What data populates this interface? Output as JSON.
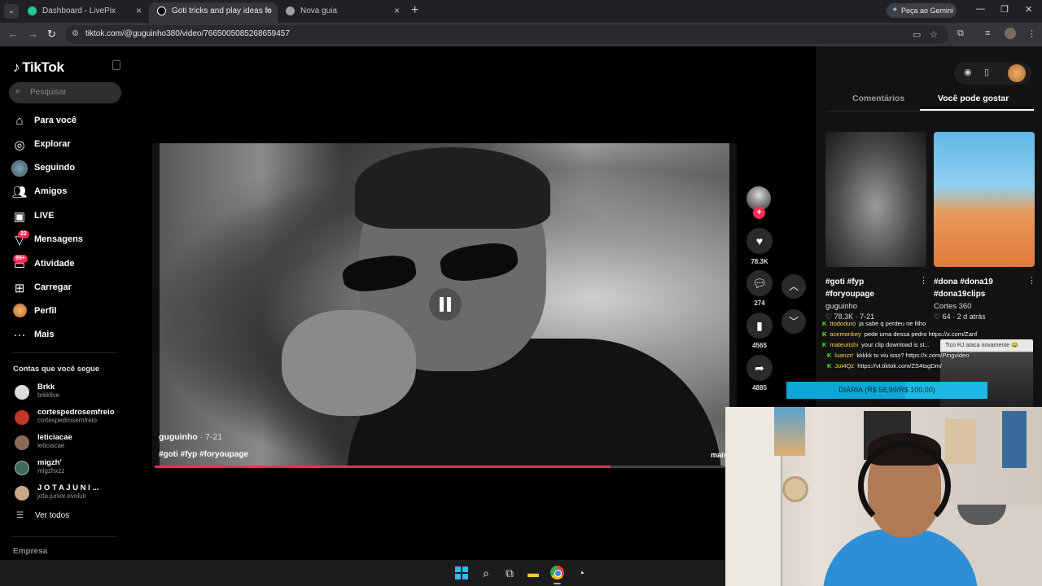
{
  "browser": {
    "tabs": [
      {
        "title": "Dashboard - LivePix",
        "active": false
      },
      {
        "title": "Goti tricks and play ideas fo",
        "active": true
      },
      {
        "title": "Nova guia",
        "active": false
      }
    ],
    "new_tab": "+",
    "gemini_label": "Peça ao Gemini",
    "url": "tiktok.com/@guguinho380/video/7665005085268659457"
  },
  "sidebar": {
    "logo": "TikTok",
    "search_placeholder": "Pesquisar",
    "nav": [
      {
        "label": "Para você",
        "icon": "home-icon"
      },
      {
        "label": "Explorar",
        "icon": "compass-icon"
      },
      {
        "label": "Seguindo",
        "icon": "following-avatar"
      },
      {
        "label": "Amigos",
        "icon": "friends-icon"
      },
      {
        "label": "LIVE",
        "icon": "live-icon"
      },
      {
        "label": "Mensagens",
        "icon": "messages-icon",
        "badge": "22"
      },
      {
        "label": "Atividade",
        "icon": "activity-icon",
        "badge": "99+"
      },
      {
        "label": "Carregar",
        "icon": "upload-icon"
      },
      {
        "label": "Perfil",
        "icon": "profile-avatar"
      },
      {
        "label": "Mais",
        "icon": "more-icon"
      }
    ],
    "following_title": "Contas que você segue",
    "following": [
      {
        "name": "Brkk",
        "handle": "brkklive"
      },
      {
        "name": "cortespedrosemfreio",
        "handle": "cortespedrosemfreio"
      },
      {
        "name": "leticiacae",
        "handle": "leticiacae"
      },
      {
        "name": "migzh'",
        "handle": "migzhxzz"
      },
      {
        "name": "J O T A  J U N I ...",
        "handle": "jota.junior.evoluir"
      }
    ],
    "see_all": "Ver todos",
    "company": "Empresa"
  },
  "video": {
    "author": "guguinho",
    "date": " · 7-21",
    "tags": "#goti #fyp #foryoupage",
    "more": "mais",
    "progress": 0.8
  },
  "actions": {
    "likes": "78.3K",
    "comments": "274",
    "saves": "4565",
    "shares": "4885"
  },
  "right_panel": {
    "tabs": [
      "Comentários",
      "Você pode gostar"
    ],
    "active_tab": 1,
    "cards": [
      {
        "line1": "#goti #fyp",
        "line2": "#foryoupage",
        "author": "guguinho",
        "stats": "♡ 78.3K · 7-21"
      },
      {
        "line1": "#dona #dona19",
        "line2": "#dona19clips",
        "author": "Cortes 360",
        "stats": "♡ 64 · 2 d atrás"
      }
    ]
  },
  "stream_overlay": {
    "chat": [
      {
        "user": "ttododuro",
        "msg": "ja sabe q perdeu ne filho"
      },
      {
        "user": "acemonkey",
        "msg": "pede uma dessa pedro https://x.com/Zanf"
      },
      {
        "user": "mateurishi",
        "msg": "your clip download is st..."
      },
      {
        "user": "luanzrr",
        "msg": "kkkkk tu viu isso? https://x.com/Pingvideo"
      },
      {
        "user": "Jot4Qz",
        "msg": "https://vt.tiktok.com/ZS4tsgDm/"
      }
    ],
    "alert_text": "Tico RJ ataca novamente 😂",
    "goal_text": "DIÁRIA (R$ 58,99/R$ 100,00)",
    "goal_progress": 0.59
  }
}
